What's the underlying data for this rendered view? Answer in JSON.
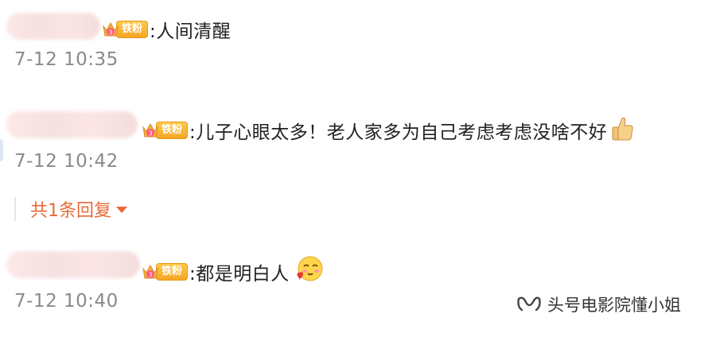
{
  "badge": {
    "label": "铁粉",
    "level": "3"
  },
  "comments": [
    {
      "text": ":人间清醒",
      "time": "7-12 10:35"
    },
    {
      "text": ":儿子心眼太多！老人家多为自己考虑考虑没啥不好",
      "time": "7-12 10:42",
      "reply_label": "共1条回复"
    },
    {
      "text": ":都是明白人",
      "time": "7-12 10:40"
    }
  ],
  "watermark": {
    "text": "头号电影院懂小姐"
  },
  "icons": [
    "crown-icon",
    "thumbs-up-icon",
    "blush-heart-emoji-icon",
    "wechat-channel-icon",
    "chevron-down-icon"
  ],
  "colors": {
    "accent": "#e86a3a",
    "timestamp": "#8a8a8a",
    "badge": "#f5a623"
  }
}
